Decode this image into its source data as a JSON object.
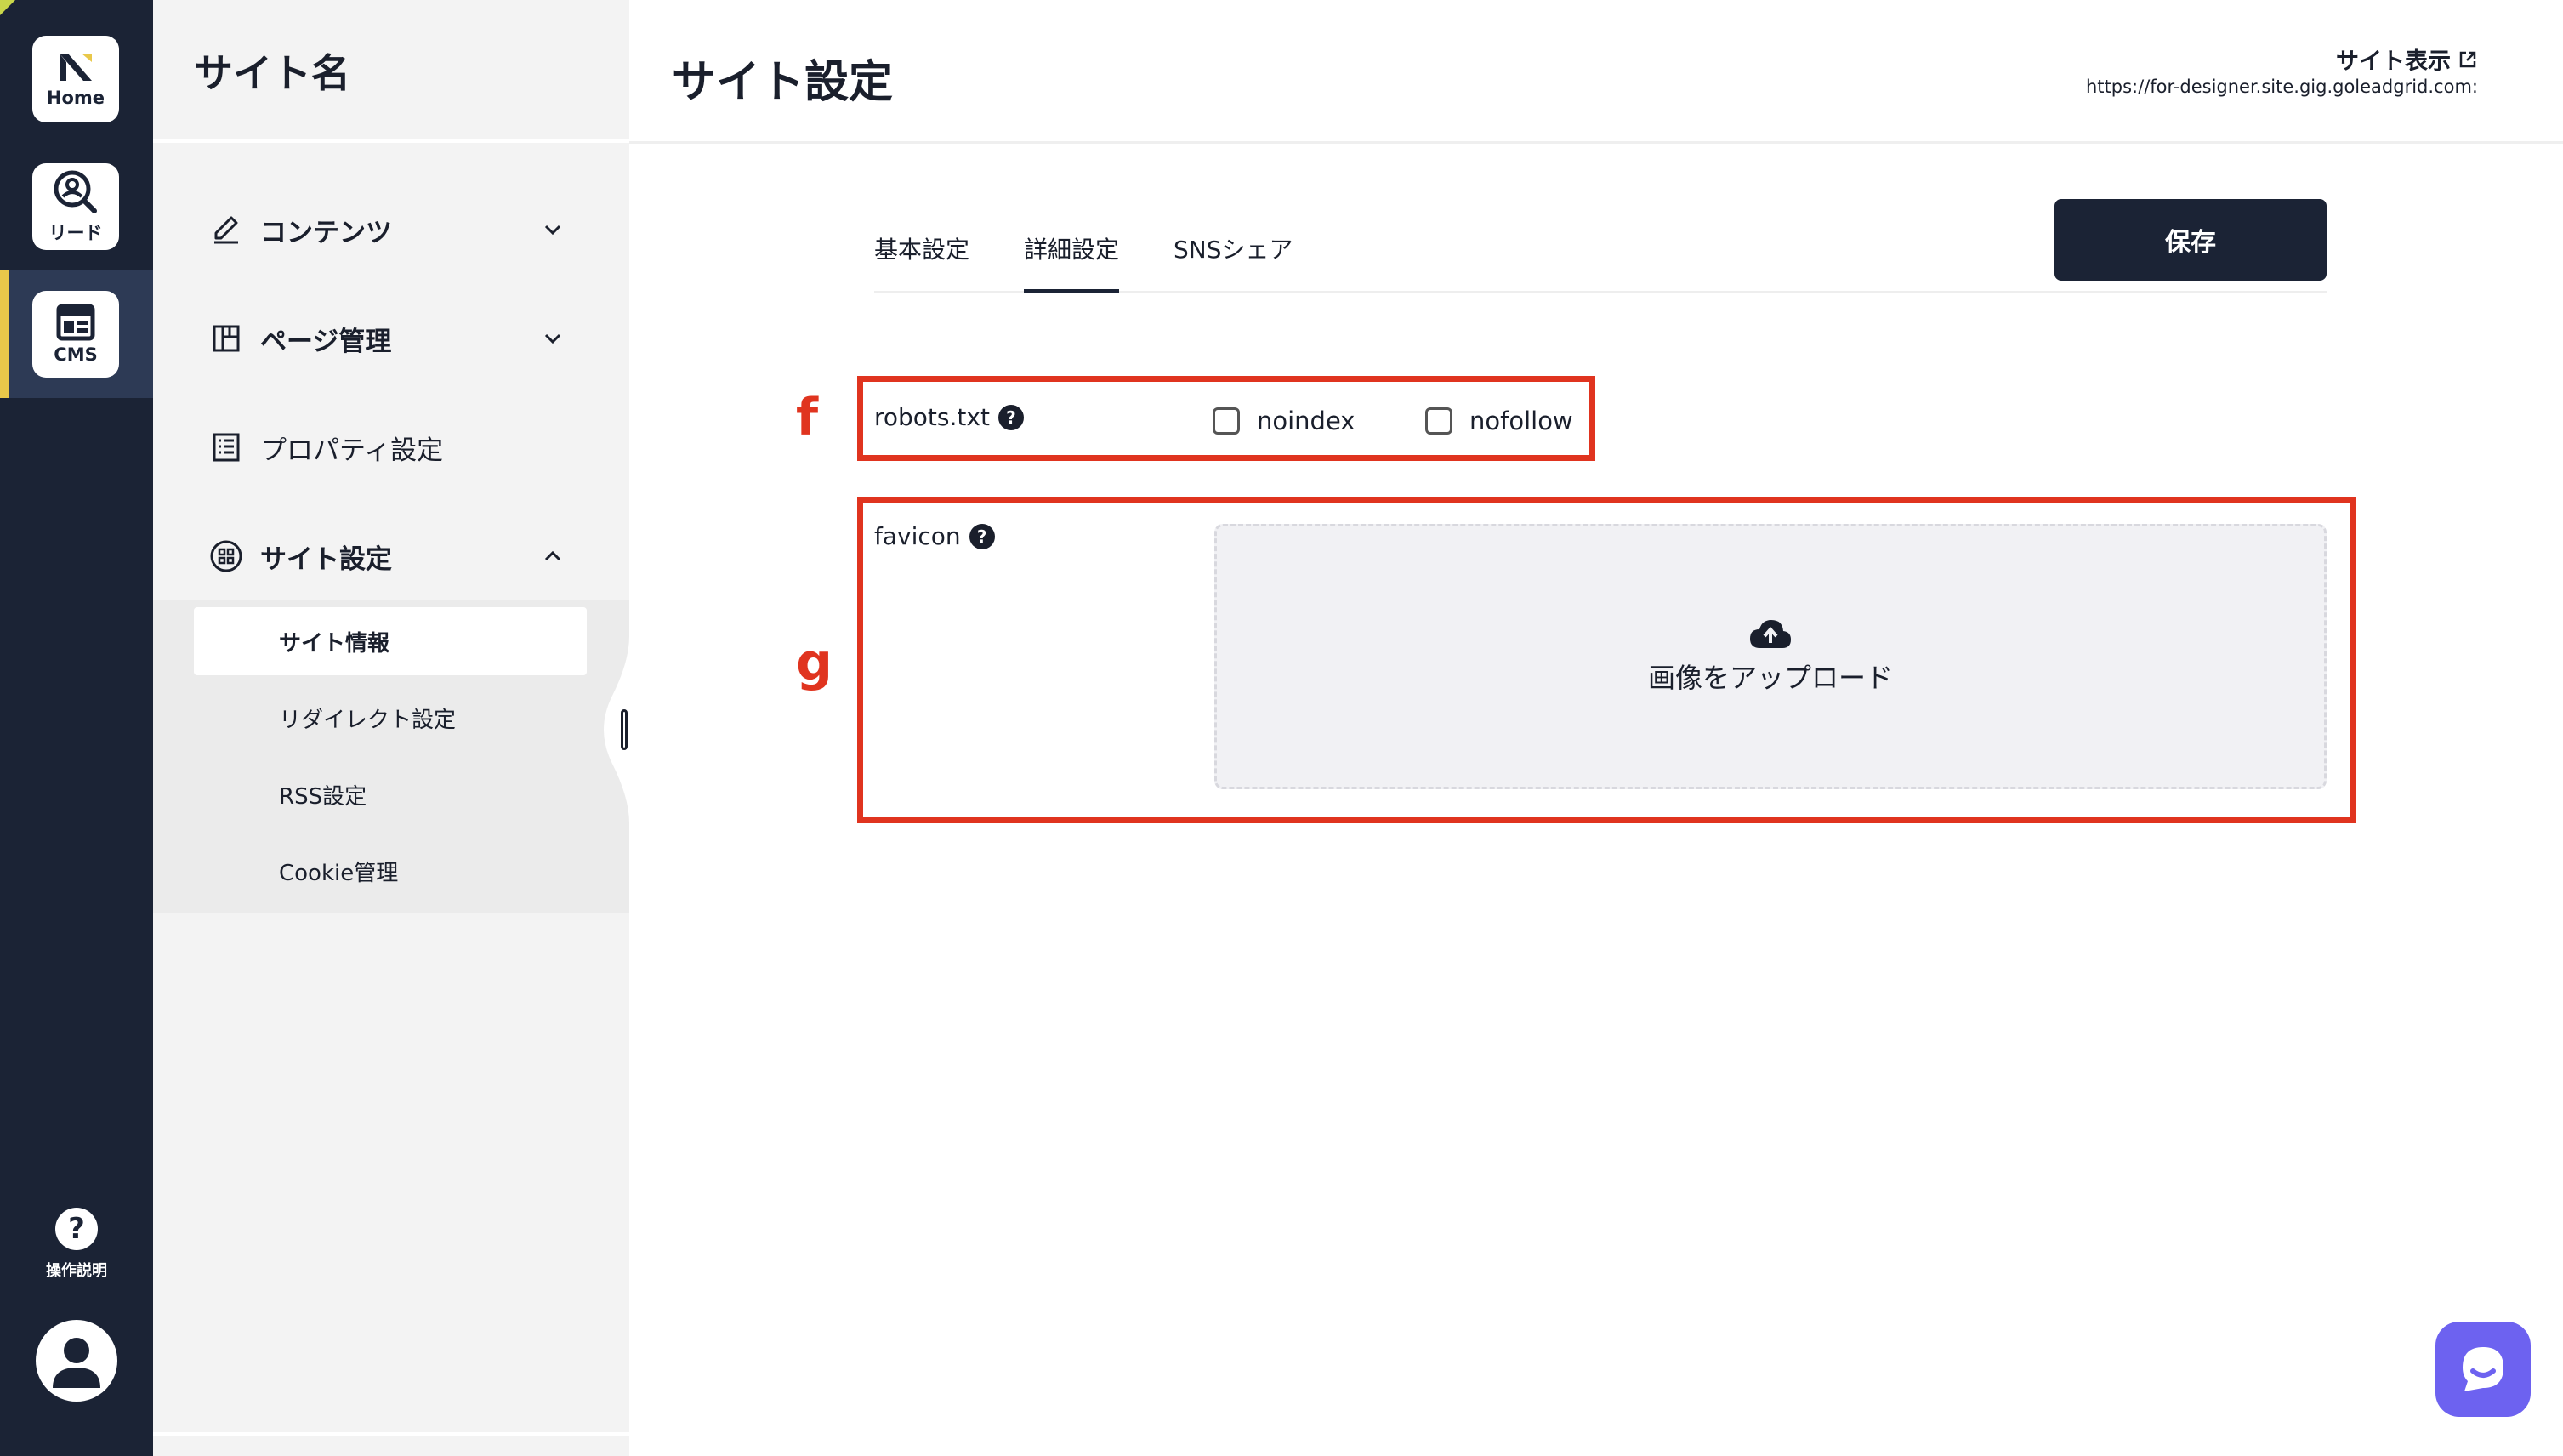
{
  "rail": {
    "home_label": "Home",
    "lead_label": "リード",
    "cms_label": "CMS",
    "help_label": "操作説明",
    "help_glyph": "?"
  },
  "sidebar": {
    "site_name": "サイト名",
    "items": [
      {
        "label": "コンテンツ",
        "icon": "pencil-icon"
      },
      {
        "label": "ページ管理",
        "icon": "layout-icon"
      },
      {
        "label": "プロパティ設定",
        "icon": "list-icon"
      },
      {
        "label": "サイト設定",
        "icon": "grid-icon"
      }
    ],
    "subitems": [
      {
        "label": "サイト情報"
      },
      {
        "label": "リダイレクト設定"
      },
      {
        "label": "RSS設定"
      },
      {
        "label": "Cookie管理"
      }
    ]
  },
  "header": {
    "title": "サイト設定",
    "site_view_label": "サイト表示",
    "site_url": "https://for-designer.site.gig.goleadgrid.com:"
  },
  "tabs": [
    {
      "label": "基本設定"
    },
    {
      "label": "詳細設定"
    },
    {
      "label": "SNSシェア"
    }
  ],
  "toolbar": {
    "save_label": "保存"
  },
  "robots": {
    "marker": "f",
    "label": "robots.txt",
    "noindex_label": "noindex",
    "nofollow_label": "nofollow"
  },
  "favicon": {
    "marker": "g",
    "label": "favicon",
    "upload_label": "画像をアップロード"
  },
  "colors": {
    "rail": "#1b2335",
    "accent": "#e9c84a",
    "annotation": "#e0341f",
    "chat": "#6d62f0"
  }
}
